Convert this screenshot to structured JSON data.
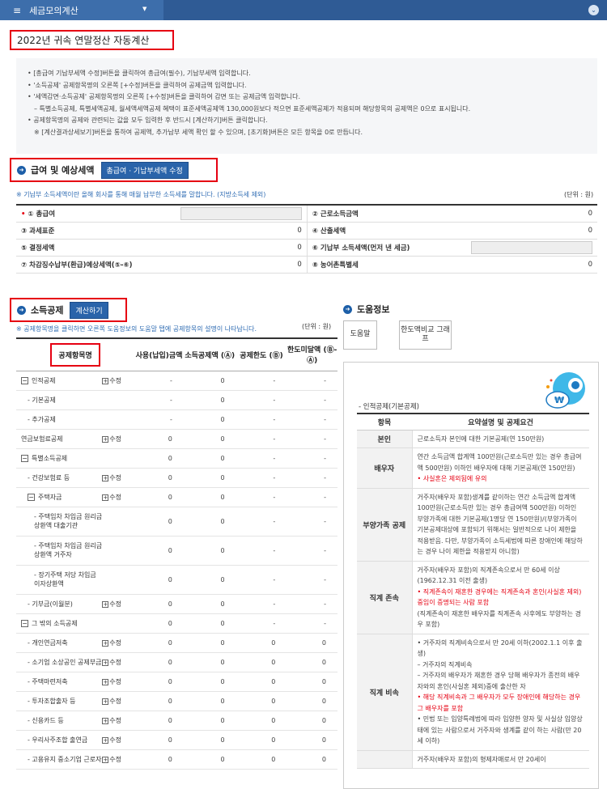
{
  "topbar": {
    "menu_label": "세금모의계산"
  },
  "page_title": "2022년 귀속 연말정산 자동계산",
  "notice_lines": [
    "• [총급여 기납부세액 수정]버튼을 클릭하여 총급여(필수), 기납부세액 입력합니다.",
    "• '소득공제' 공제항목명의 오른쪽 [+수정]버튼을 클릭하여 공제금액 입력합니다.",
    "• '세액감면·소득공제' 공제항목명의 오른쪽 [+수정]버튼을 클릭하여 감면 또는 공제금액 입력합니다.",
    "– 특별소득공제, 특별세액공제, 월세액세액공제 혜택이 표준세액공제액 130,000원보다 적으면 표준세액공제가 적용되며 해당항목의 공제액은 0으로 표시됩니다.",
    "• 공제항목명의 공제와 관련되는 값을 모두 입력한 후 반드시 [계산하기]버튼 클릭합니다.",
    "※ [계산결과상세보기]버튼을 통하여 공제액, 추가납부 세액 확인 할 수 있으며, [초기화]버튼은 모든 항목을 0로 만듭니다."
  ],
  "salary_section": {
    "title": "급여 및 예상세액",
    "edit_button": "총급여 · 기납부세액 수정",
    "note": "※ 기납부 소득세액이란 올해 회사를 통해 매월 납부한 소득세를 말합니다. (지방소득세 제외)",
    "unit": "(단위 : 원)",
    "rows": [
      {
        "left_label": "① 총급여",
        "left_value": "",
        "right_label": "② 근로소득금액",
        "right_value": "0"
      },
      {
        "left_label": "③ 과세표준",
        "left_value": "0",
        "right_label": "④ 산출세액",
        "right_value": "0"
      },
      {
        "left_label": "⑤ 결정세액",
        "left_value": "0",
        "right_label": "⑥ 기납부 소득세액(먼저 낸 세금)",
        "right_value": ""
      },
      {
        "left_label": "⑦ 차감징수납부(환급)예상세액(⑤-⑥)",
        "left_value": "0",
        "right_label": "⑧ 농어촌특별세",
        "right_value": "0"
      }
    ]
  },
  "deduction_section": {
    "title": "소득공제",
    "calc_button": "계산하기",
    "note": "※ 공제항목명을 클릭하면 오른쪽 도움정보의 도움말 탭에 공제항목의 설명이 나타납니다.",
    "unit": "(단위 : 원)",
    "headers": [
      "공제항목명",
      "사용(납입)금액",
      "소득공제액 (Ⓐ)",
      "공제한도 (Ⓑ)",
      "한도미달액 (Ⓑ-Ⓐ)"
    ],
    "edit_label": "수정",
    "rows": [
      {
        "name": "인적공제",
        "tree": "minus",
        "indent": 0,
        "edit": true,
        "used": "-",
        "ded": "0",
        "limit": "-",
        "short": "-"
      },
      {
        "name": "- 기본공제",
        "tree": "",
        "indent": 1,
        "edit": false,
        "used": "-",
        "ded": "0",
        "limit": "-",
        "short": "-"
      },
      {
        "name": "- 추가공제",
        "tree": "",
        "indent": 1,
        "edit": false,
        "used": "-",
        "ded": "0",
        "limit": "-",
        "short": "-"
      },
      {
        "name": "연금보험료공제",
        "tree": "",
        "indent": 0,
        "edit": true,
        "used": "0",
        "ded": "0",
        "limit": "-",
        "short": "-"
      },
      {
        "name": "특별소득공제",
        "tree": "minus",
        "indent": 0,
        "edit": false,
        "used": "0",
        "ded": "0",
        "limit": "-",
        "short": "-"
      },
      {
        "name": "- 건강보험료 등",
        "tree": "",
        "indent": 1,
        "edit": true,
        "used": "0",
        "ded": "0",
        "limit": "-",
        "short": "-"
      },
      {
        "name": "주택자금",
        "tree": "minus",
        "indent": 1,
        "edit": true,
        "used": "0",
        "ded": "0",
        "limit": "-",
        "short": "-"
      },
      {
        "name": "- 주택임차 차입금 원리금상환액 대출기관",
        "tree": "",
        "indent": 2,
        "edit": false,
        "used": "0",
        "ded": "0",
        "limit": "-",
        "short": "-"
      },
      {
        "name": "- 주택임차 차입금 원리금상환액 거주자",
        "tree": "",
        "indent": 2,
        "edit": false,
        "used": "0",
        "ded": "0",
        "limit": "-",
        "short": "-"
      },
      {
        "name": "- 장기주택 저당 차입금 이자상환액",
        "tree": "",
        "indent": 2,
        "edit": false,
        "used": "0",
        "ded": "0",
        "limit": "-",
        "short": "-"
      },
      {
        "name": "- 기부금(이월분)",
        "tree": "",
        "indent": 1,
        "edit": true,
        "used": "0",
        "ded": "0",
        "limit": "-",
        "short": "-"
      },
      {
        "name": "그 밖의 소득공제",
        "tree": "minus",
        "indent": 0,
        "edit": false,
        "used": "0",
        "ded": "0",
        "limit": "-",
        "short": "-"
      },
      {
        "name": "- 개인연금저축",
        "tree": "",
        "indent": 1,
        "edit": true,
        "used": "0",
        "ded": "0",
        "limit": "0",
        "short": "0"
      },
      {
        "name": "- 소기업 소상공인 공제부금",
        "tree": "",
        "indent": 1,
        "edit": true,
        "used": "0",
        "ded": "0",
        "limit": "0",
        "short": "0"
      },
      {
        "name": "- 주택마련저축",
        "tree": "",
        "indent": 1,
        "edit": true,
        "used": "0",
        "ded": "0",
        "limit": "0",
        "short": "0"
      },
      {
        "name": "- 투자조합출자 등",
        "tree": "",
        "indent": 1,
        "edit": true,
        "used": "0",
        "ded": "0",
        "limit": "0",
        "short": "0"
      },
      {
        "name": "- 신용카드 등",
        "tree": "",
        "indent": 1,
        "edit": true,
        "used": "0",
        "ded": "0",
        "limit": "0",
        "short": "0"
      },
      {
        "name": "- 우리사주조합 출연금",
        "tree": "",
        "indent": 1,
        "edit": true,
        "used": "0",
        "ded": "0",
        "limit": "0",
        "short": "0"
      },
      {
        "name": "- 고용유지 중소기업 근로자",
        "tree": "",
        "indent": 1,
        "edit": true,
        "used": "0",
        "ded": "0",
        "limit": "0",
        "short": "0"
      }
    ]
  },
  "help_section": {
    "title": "도움정보",
    "tab_help": "도움말",
    "tab_graph": "한도액비교 그래프",
    "caption": "- 인적공제(기본공제)",
    "col_item": "항목",
    "col_desc": "요약설명 및 공제요건",
    "mascot_text": "₩",
    "rows": [
      {
        "key": "본인",
        "lines": [
          {
            "t": "근로소득자 본인에 대한 기본공제(연 150만원)",
            "red": false
          }
        ]
      },
      {
        "key": "배우자",
        "lines": [
          {
            "t": "연간 소득금액 합계액 100만원(근로소득만 있는 경우 총급여액 500만원) 이하인 배우자에 대해 기본공제(연 150만원)",
            "red": false
          },
          {
            "t": "• 사실혼은 제외됨에 유의",
            "red": true
          }
        ]
      },
      {
        "key": "부양가족 공제",
        "lines": [
          {
            "t": "거주자(배우자 포함)생계를 같이하는 연간 소득금액 합계액 100만원(근로소득만 있는 경우 총급여액 500만원) 이하인 부양가족에 대한 기본공제(1명당 연 150만원)/(부양가족이 기본공제대상에 포함되기 위해서는 일반적으로 나이 제한을 적용받음. 다만, 부양가족이 소득세법에 따른 장애인에 해당하는 경우 나이 제한을 적용받지 아니함)",
            "red": false
          }
        ]
      },
      {
        "key": "직계 존속",
        "lines": [
          {
            "t": "거주자(배우자 포함)의 직계존속으로서 만 60세 이상(1962.12.31 이전 출생)",
            "red": false
          },
          {
            "t": "• 직계존속이 재혼한 경우에는 직계존속과 혼인(사실혼 제외) 중임이 증명되는 사람 포함",
            "red": true
          },
          {
            "t": "(직계존속이 재혼한 배우자를 직계존속 사후에도 부양하는 경우 포함)",
            "red": false
          }
        ]
      },
      {
        "key": "직계 비속",
        "lines": [
          {
            "t": "• 거주자의 직계비속으로서 만 20세 이하(2002.1.1 이후 출생)",
            "red": false
          },
          {
            "t": "– 거주자의 직계비속",
            "red": false
          },
          {
            "t": "– 거주자의 배우자가 재혼한 경우 당해 배우자가 종전의 배우자와의 혼인(사실혼 제외)중에 출산한 자",
            "red": false
          },
          {
            "t": "• 해당 직계비속과 그 배우자가 모두 장애인에 해당하는 경우 그 배우자를 포함",
            "red": true
          },
          {
            "t": "• 민법 또는 입양특례법에 따라 입양한 양자 및 사실상 입양상태에 있는 사람으로서 거주자와 생계를 같이 하는 사람(만 20세 이하)",
            "red": false
          }
        ]
      },
      {
        "key": "",
        "lines": [
          {
            "t": "거주자(배우자 포함)의 형제자매로서 만 20세이",
            "red": false
          }
        ]
      }
    ]
  }
}
